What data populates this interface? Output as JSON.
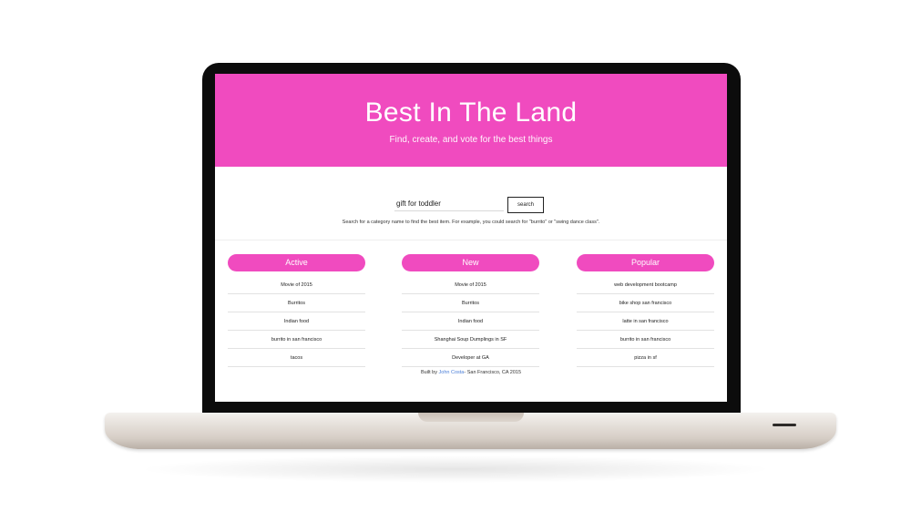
{
  "hero": {
    "title": "Best In The Land",
    "subtitle": "Find, create, and vote for the best things",
    "color": "#f04bbf"
  },
  "search": {
    "value": "gift for toddler",
    "button_label": "search",
    "help_text": "Search for a category name to find the best item. For example, you could search for \"burrito\" or \"swing dance class\"."
  },
  "columns": [
    {
      "title": "Active",
      "items": [
        "Movie of 2015",
        "Burritos",
        "Indian food",
        "burrito in san francisco",
        "tacos"
      ]
    },
    {
      "title": "New",
      "items": [
        "Movie of 2015",
        "Burritos",
        "Indian food",
        "Shanghai Soup Dumplings in SF",
        "Developer at GA"
      ]
    },
    {
      "title": "Popular",
      "items": [
        "web development bootcamp",
        "bike shop san francisco",
        "latte in san francisco",
        "burrito in san francisco",
        "pizza in sf"
      ]
    }
  ],
  "footer": {
    "prefix": "Built by ",
    "author": "John Costa",
    "suffix": "- San Francisco, CA 2015"
  }
}
